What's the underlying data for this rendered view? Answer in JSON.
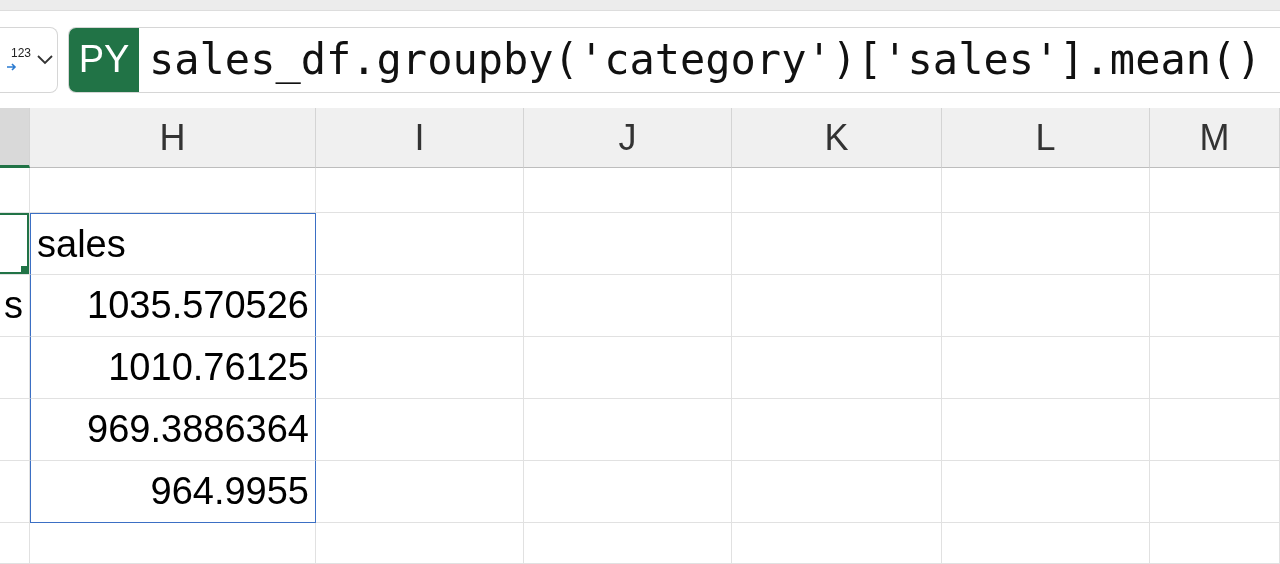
{
  "name_box": {
    "output_type": "123"
  },
  "formula_bar": {
    "badge": "PY",
    "formula": "sales_df.groupby('category')['sales'].mean()"
  },
  "columns": [
    {
      "selected": true
    },
    {
      "label": "H",
      "selected": false
    },
    {
      "label": "I",
      "selected": false
    },
    {
      "label": "J",
      "selected": false
    },
    {
      "label": "K",
      "selected": false
    },
    {
      "label": "L",
      "selected": false
    },
    {
      "label": "M",
      "selected": false
    }
  ],
  "rows": [
    {
      "kind": "header",
      "g_selected": true,
      "h": "sales"
    },
    {
      "kind": "number",
      "g_selected": false,
      "g": "s",
      "h": "1035.570526"
    },
    {
      "kind": "number",
      "g_selected": false,
      "h": "1010.76125"
    },
    {
      "kind": "number",
      "g_selected": false,
      "h": "969.3886364"
    },
    {
      "kind": "number",
      "g_selected": false,
      "h": "964.9955"
    }
  ]
}
